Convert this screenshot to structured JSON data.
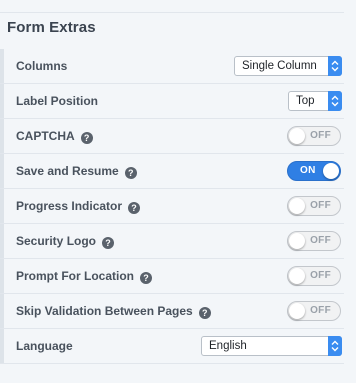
{
  "section": {
    "title": "Form Extras"
  },
  "rows": {
    "columns": {
      "label": "Columns",
      "value": "Single Column"
    },
    "label_position": {
      "label": "Label Position",
      "value": "Top"
    },
    "captcha": {
      "label": "CAPTCHA",
      "state": "OFF"
    },
    "save_resume": {
      "label": "Save and Resume",
      "state": "ON"
    },
    "progress": {
      "label": "Progress Indicator",
      "state": "OFF"
    },
    "security_logo": {
      "label": "Security Logo",
      "state": "OFF"
    },
    "prompt_location": {
      "label": "Prompt For Location",
      "state": "OFF"
    },
    "skip_validation": {
      "label": "Skip Validation Between Pages",
      "state": "OFF"
    },
    "language": {
      "label": "Language",
      "value": "English"
    }
  },
  "help_icon_glyph": "?",
  "colors": {
    "accent_blue": "#2f7fe4",
    "select_arrow_blue": "#3a8cf0",
    "background": "#f3f6f9"
  },
  "icons": {
    "help": "question-circle-icon",
    "select_arrows": "up-down-chevron-icon"
  }
}
